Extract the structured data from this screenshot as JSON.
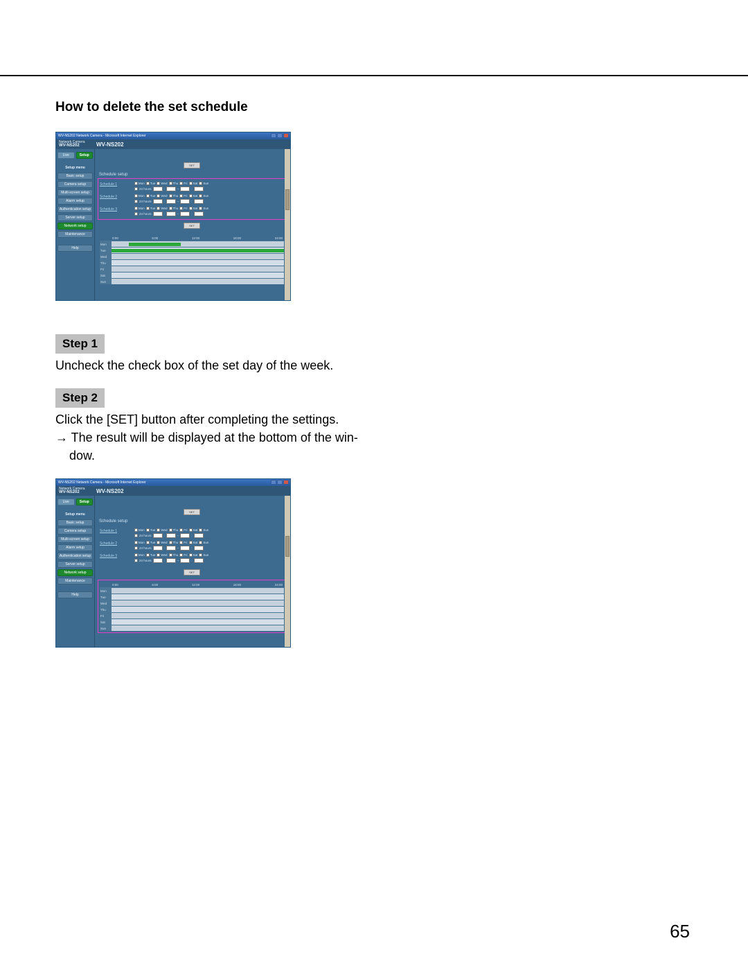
{
  "page_number": "65",
  "section_title": "How to delete the set schedule",
  "step1": {
    "label": "Step 1",
    "text": "Uncheck the check box of the set day of the week."
  },
  "step2": {
    "label": "Step 2",
    "line1": "Click the [SET] button after completing the settings.",
    "line2": "→ The result will be displayed at the bottom of the win-",
    "line3": "dow."
  },
  "screenshot": {
    "titlebar": "WV-NS202 Network Camera - Microsoft Internet Explorer",
    "header_small": "Network Camera",
    "model": "WV-NS202",
    "tabs": {
      "live": "Live",
      "setup": "Setup"
    },
    "menu_label": "Setup menu",
    "sidebar": [
      "Basic setup",
      "Camera setup",
      "Multi-screen setup",
      "Alarm setup",
      "Authentication setup",
      "Server setup",
      "Network setup",
      "Maintenance"
    ],
    "help": "Help",
    "set_btn": "SET",
    "schedule_title": "Schedule setup",
    "schedule_rows": [
      "Schedule 1",
      "Schedule 2",
      "Schedule 3"
    ],
    "days": [
      "Mon",
      "Tue",
      "Wed",
      "Thu",
      "Fri",
      "Sat",
      "Sun"
    ],
    "allday": "24 hours",
    "timeline_hours": [
      "0:00",
      "6:00",
      "12:00",
      "18:00",
      "24:00"
    ],
    "timeline_days": [
      "Mon",
      "Tue",
      "Wed",
      "Thu",
      "Fri",
      "Sat",
      "Sun"
    ]
  }
}
